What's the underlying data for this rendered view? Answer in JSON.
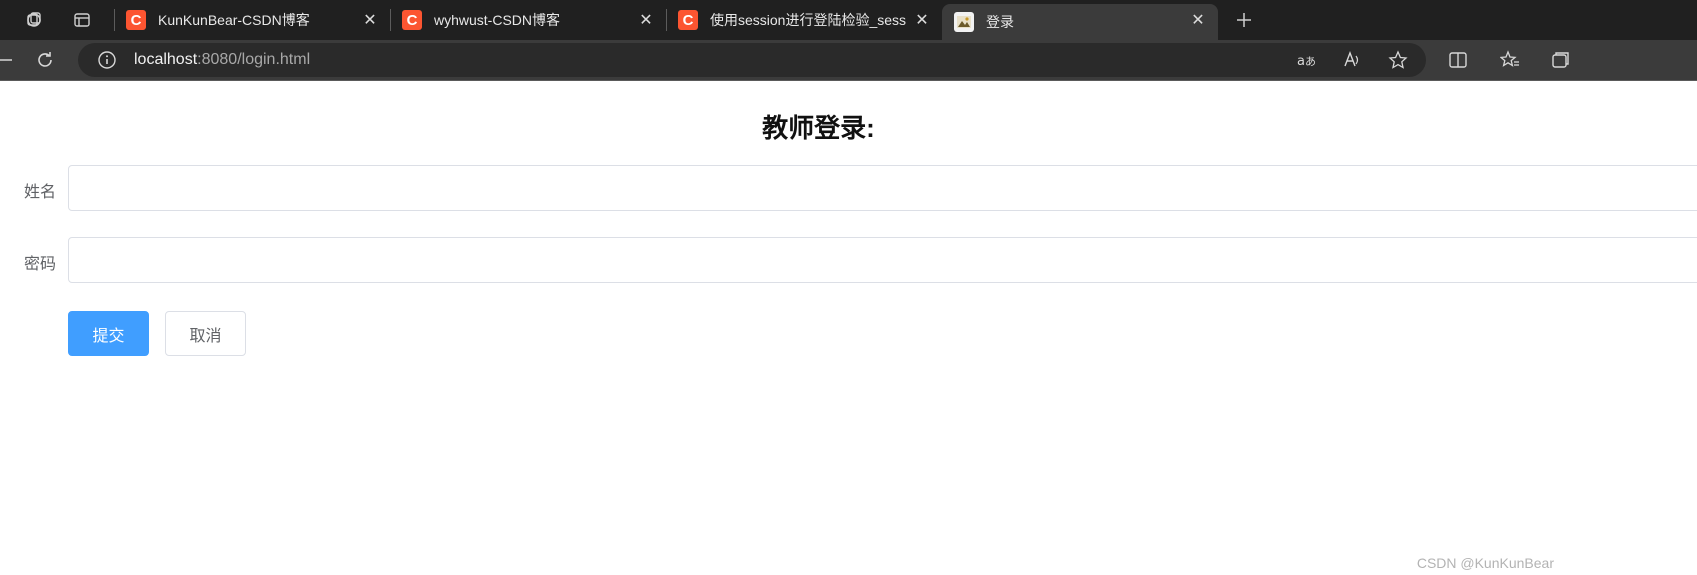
{
  "browser": {
    "tabs": [
      {
        "title": "KunKunBear-CSDN博客",
        "favicon": "csdn-logo",
        "active": false
      },
      {
        "title": "wyhwust-CSDN博客",
        "favicon": "csdn-logo",
        "active": false
      },
      {
        "title": "使用session进行登陆检验_session",
        "favicon": "csdn-logo",
        "active": false
      },
      {
        "title": "登录",
        "favicon": "page-image",
        "active": true
      }
    ],
    "address": {
      "host": "localhost",
      "rest": ":8080/login.html"
    },
    "csdn_glyph": "C",
    "close_glyph": "✕",
    "newtab_glyph": "+"
  },
  "page": {
    "heading": "教师登录:",
    "form": {
      "name_label": "姓名",
      "name_value": "",
      "password_label": "密码",
      "password_value": ""
    },
    "buttons": {
      "submit": "提交",
      "cancel": "取消"
    },
    "watermark": "CSDN @KunKunBear"
  },
  "colors": {
    "primary": "#409eff",
    "csdn_brand": "#fc5531"
  }
}
